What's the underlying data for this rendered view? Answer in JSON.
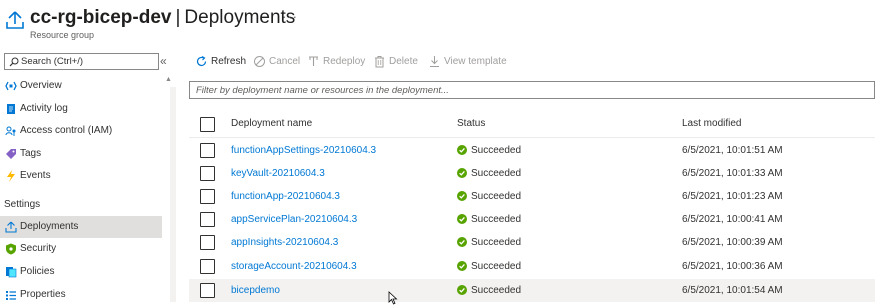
{
  "header": {
    "resource_name": "cc-rg-bicep-dev",
    "separator": "|",
    "page_name": "Deployments",
    "resource_type": "Resource group",
    "more_label": "···"
  },
  "sidebar": {
    "search_placeholder": "Search (Ctrl+/)",
    "collapse_label": "«",
    "scroll_up_label": "▲",
    "items": [
      {
        "label": "Overview",
        "icon": "overview-icon",
        "color": "#0078d4"
      },
      {
        "label": "Activity log",
        "icon": "activity-log-icon",
        "color": "#0078d4"
      },
      {
        "label": "Access control (IAM)",
        "icon": "iam-icon",
        "color": "#0078d4"
      },
      {
        "label": "Tags",
        "icon": "tag-icon",
        "color": "#8661c5"
      },
      {
        "label": "Events",
        "icon": "events-icon",
        "color": "#ffb900"
      }
    ],
    "section_label": "Settings",
    "settings_items": [
      {
        "label": "Deployments",
        "icon": "deployments-icon",
        "color": "#0078d4",
        "active": true
      },
      {
        "label": "Security",
        "icon": "security-icon",
        "color": "#57a300"
      },
      {
        "label": "Policies",
        "icon": "policies-icon",
        "color": "#0078d4"
      },
      {
        "label": "Properties",
        "icon": "properties-icon",
        "color": "#0078d4"
      }
    ]
  },
  "toolbar": {
    "refresh": "Refresh",
    "cancel": "Cancel",
    "redeploy": "Redeploy",
    "delete": "Delete",
    "view_template": "View template"
  },
  "filter": {
    "placeholder": "Filter by deployment name or resources in the deployment..."
  },
  "table": {
    "columns": [
      "Deployment name",
      "Status",
      "Last modified"
    ],
    "rows": [
      {
        "name": "functionAppSettings-20210604.3",
        "status": "Succeeded",
        "modified": "6/5/2021, 10:01:51 AM"
      },
      {
        "name": "keyVault-20210604.3",
        "status": "Succeeded",
        "modified": "6/5/2021, 10:01:33 AM"
      },
      {
        "name": "functionApp-20210604.3",
        "status": "Succeeded",
        "modified": "6/5/2021, 10:01:23 AM"
      },
      {
        "name": "appServicePlan-20210604.3",
        "status": "Succeeded",
        "modified": "6/5/2021, 10:00:41 AM"
      },
      {
        "name": "appInsights-20210604.3",
        "status": "Succeeded",
        "modified": "6/5/2021, 10:00:39 AM"
      },
      {
        "name": "storageAccount-20210604.3",
        "status": "Succeeded",
        "modified": "6/5/2021, 10:00:36 AM"
      },
      {
        "name": "bicepdemo",
        "status": "Succeeded",
        "modified": "6/5/2021, 10:01:54 AM"
      }
    ]
  },
  "colors": {
    "link": "#0078d4",
    "success": "#57a300",
    "disabled_text": "#a19f9d",
    "active_nav": "#e1dfdd"
  }
}
